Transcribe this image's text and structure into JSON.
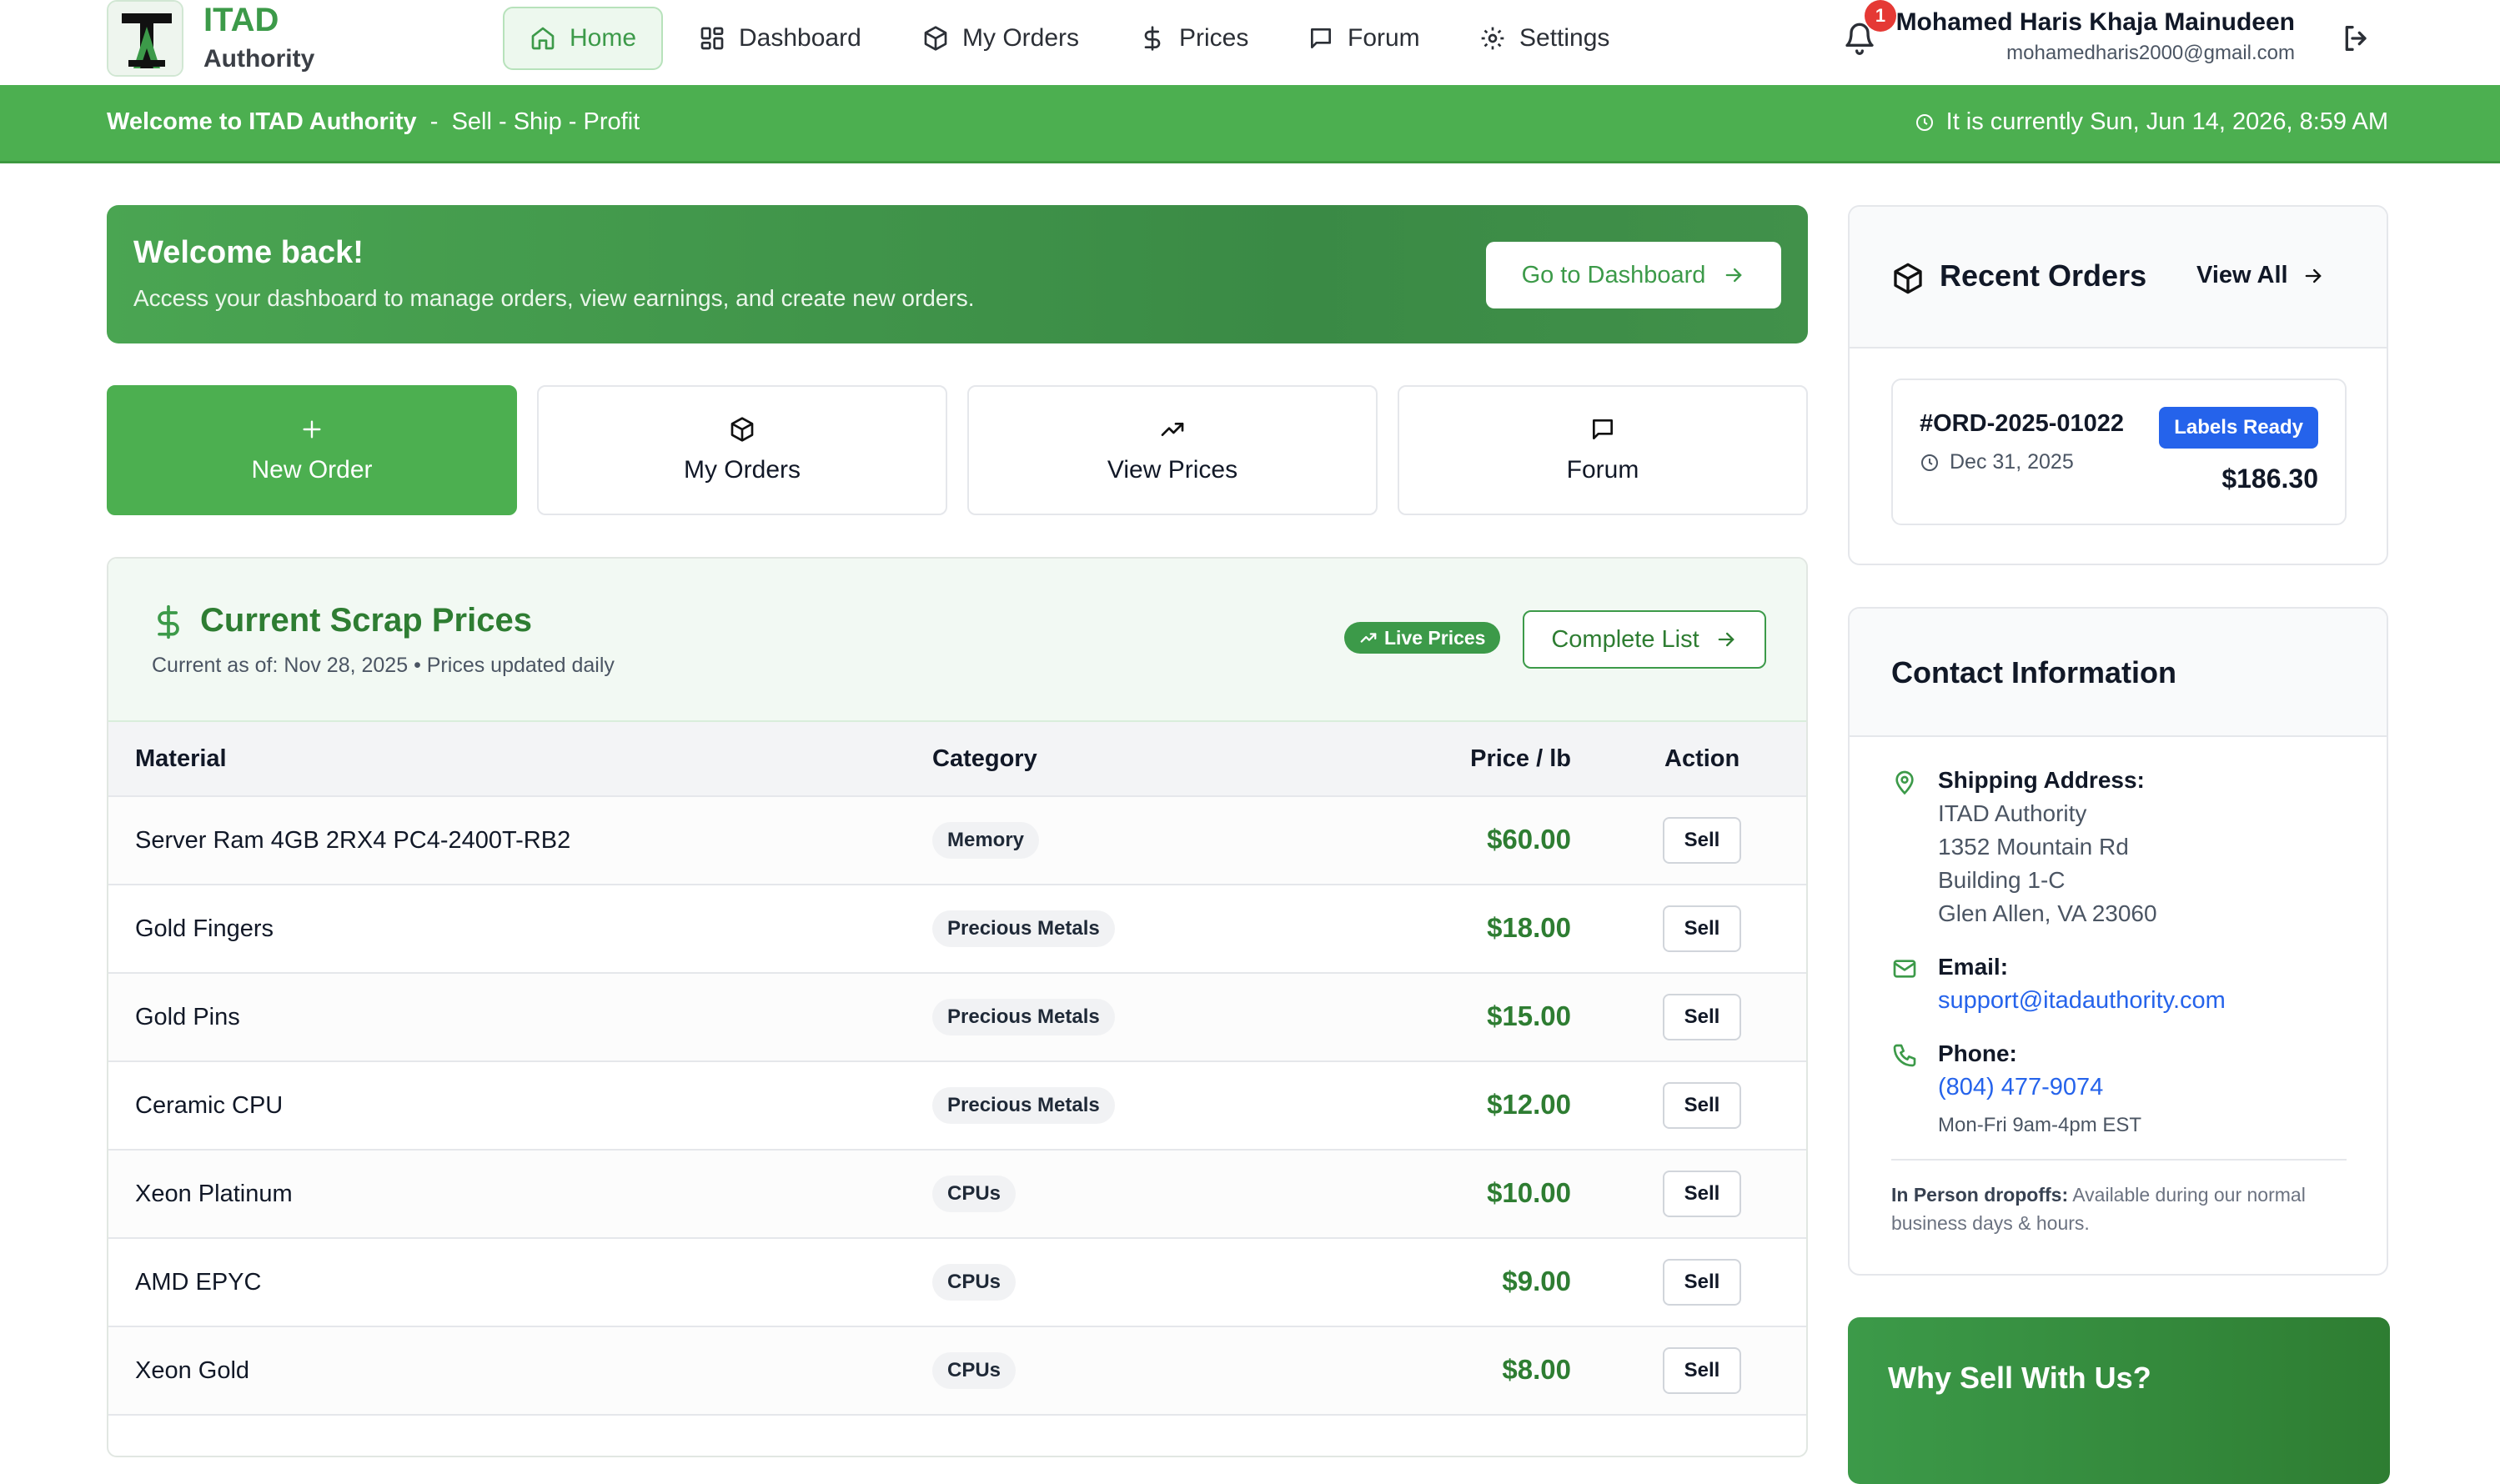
{
  "brand": {
    "title": "ITAD",
    "subtitle": "Authority"
  },
  "nav": {
    "items": [
      {
        "label": "Home",
        "icon": "home-icon",
        "active": true
      },
      {
        "label": "Dashboard",
        "icon": "dashboard-icon"
      },
      {
        "label": "My Orders",
        "icon": "package-icon"
      },
      {
        "label": "Prices",
        "icon": "dollar-icon"
      },
      {
        "label": "Forum",
        "icon": "chat-icon"
      },
      {
        "label": "Settings",
        "icon": "gear-icon"
      }
    ],
    "notification_count": "1",
    "user_name": "Mohamed Haris Khaja Mainudeen",
    "user_email": "mohamedharis2000@gmail.com"
  },
  "banner": {
    "welcome": "Welcome to ITAD Authority",
    "separator": "-",
    "tagline": "Sell - Ship - Profit",
    "datetime": "It is currently Sun, Jun 14, 2026, 8:59 AM"
  },
  "hero": {
    "title": "Welcome back!",
    "subtitle": "Access your dashboard to manage orders, view earnings, and create new orders.",
    "button": "Go to Dashboard"
  },
  "quick_actions": [
    {
      "label": "New Order",
      "icon": "plus-icon"
    },
    {
      "label": "My Orders",
      "icon": "package-icon"
    },
    {
      "label": "View Prices",
      "icon": "trending-up-icon"
    },
    {
      "label": "Forum",
      "icon": "chat-icon"
    }
  ],
  "prices": {
    "title": "Current Scrap Prices",
    "subtitle": "Current as of: Nov 28, 2025 • Prices updated daily",
    "live_badge": "Live Prices",
    "complete_list": "Complete List",
    "columns": [
      "Material",
      "Category",
      "Price / lb",
      "Action"
    ],
    "rows": [
      {
        "material": "Server Ram 4GB 2RX4 PC4-2400T-RB2",
        "category": "Memory",
        "price": "$60.00",
        "action": "Sell"
      },
      {
        "material": "Gold Fingers",
        "category": "Precious Metals",
        "price": "$18.00",
        "action": "Sell"
      },
      {
        "material": "Gold Pins",
        "category": "Precious Metals",
        "price": "$15.00",
        "action": "Sell"
      },
      {
        "material": "Ceramic CPU",
        "category": "Precious Metals",
        "price": "$12.00",
        "action": "Sell"
      },
      {
        "material": "Xeon Platinum",
        "category": "CPUs",
        "price": "$10.00",
        "action": "Sell"
      },
      {
        "material": "AMD EPYC",
        "category": "CPUs",
        "price": "$9.00",
        "action": "Sell"
      },
      {
        "material": "Xeon Gold",
        "category": "CPUs",
        "price": "$8.00",
        "action": "Sell"
      }
    ]
  },
  "recent_orders": {
    "title": "Recent Orders",
    "view_all": "View All",
    "orders": [
      {
        "id": "#ORD-2025-01022",
        "date": "Dec 31, 2025",
        "status": "Labels Ready",
        "amount": "$186.30"
      }
    ]
  },
  "contact": {
    "title": "Contact Information",
    "shipping_label": "Shipping Address:",
    "address_lines": [
      "ITAD Authority",
      "1352 Mountain Rd",
      "Building 1-C",
      "Glen Allen, VA 23060"
    ],
    "email_label": "Email:",
    "email": "support@itadauthority.com",
    "phone_label": "Phone:",
    "phone": "(804) 477-9074",
    "hours": "Mon-Fri 9am-4pm EST",
    "dropoff_label": "In Person dropoffs:",
    "dropoff_text": " Available during our normal business days & hours."
  },
  "why_sell": {
    "title": "Why Sell With Us?"
  },
  "colors": {
    "brand_green": "#4caf50",
    "dark_green": "#2e7d32",
    "link_blue": "#2563eb",
    "badge_red": "#e53935"
  }
}
